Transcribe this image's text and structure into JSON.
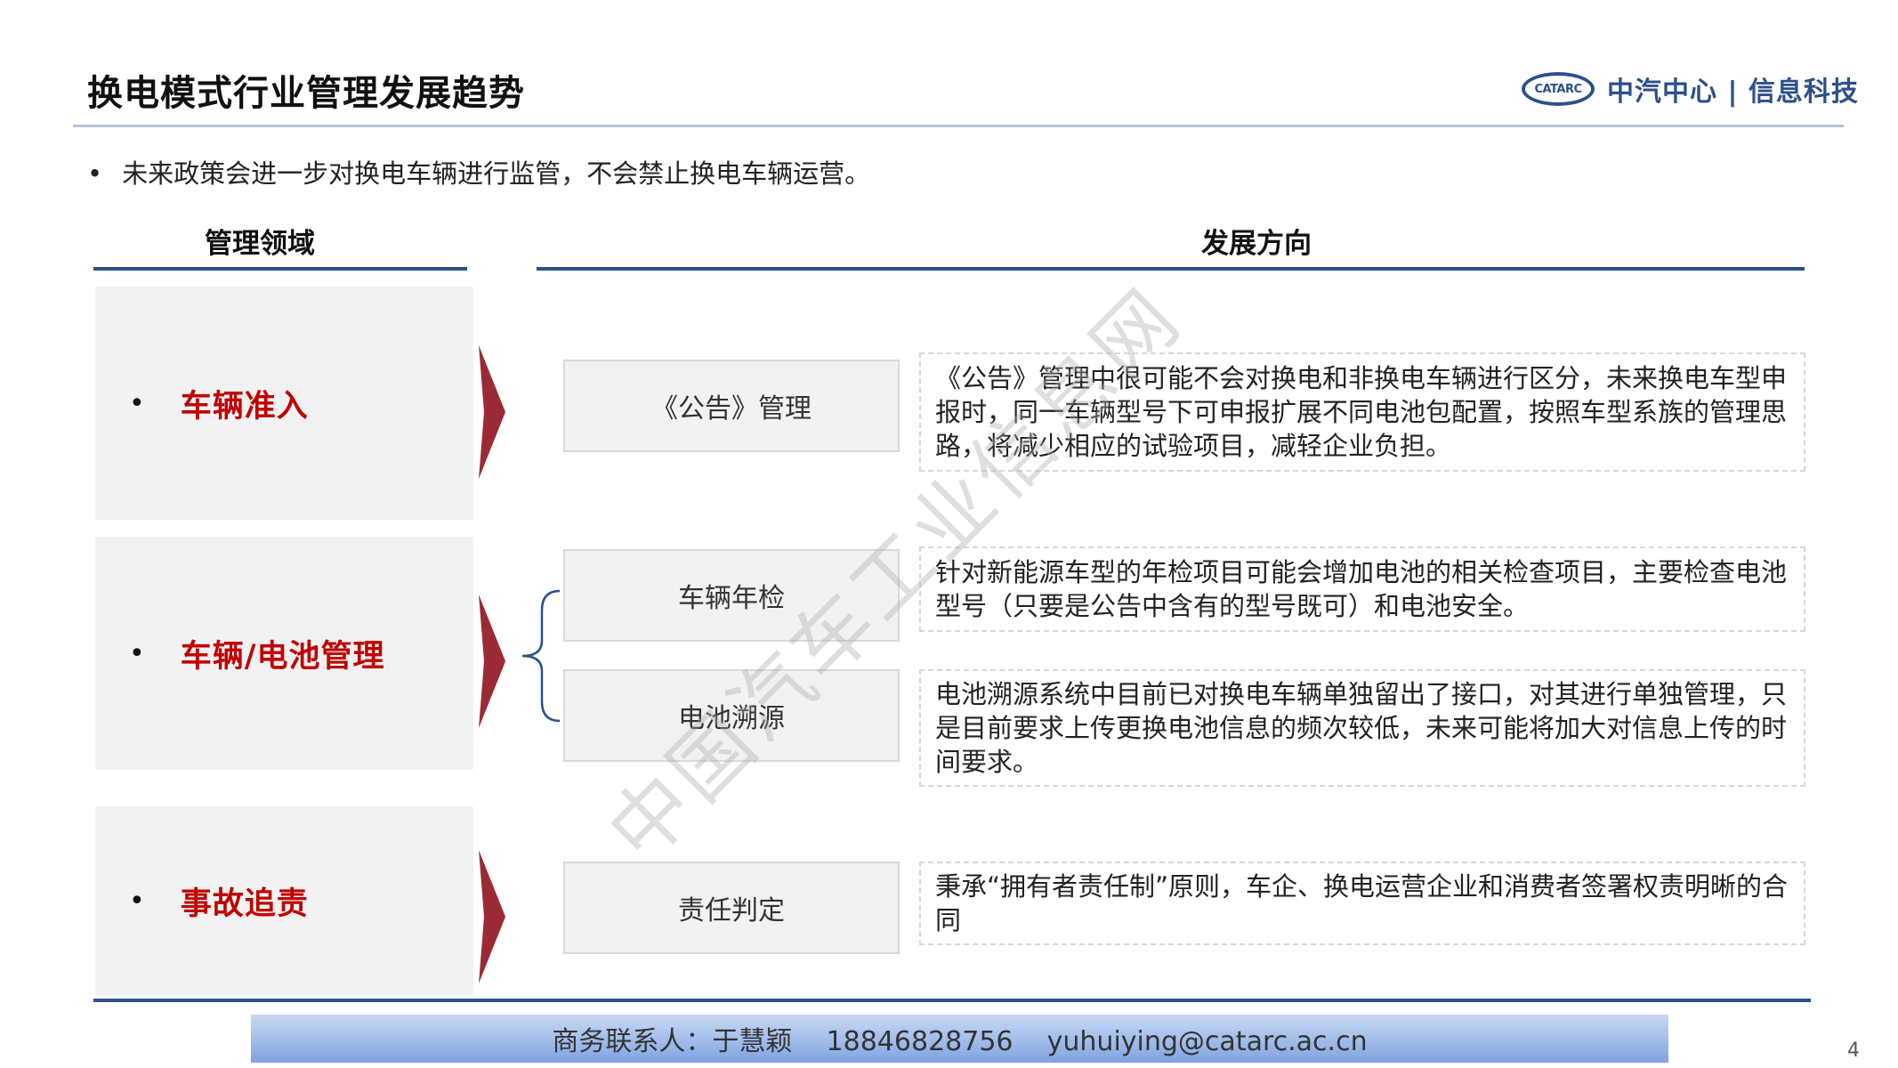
{
  "header": {
    "title": "换电模式行业管理发展趋势",
    "logo_mark": "CATARC",
    "logo_text": "中汽中心 | 信息科技",
    "brand_color": "#2d4f8c"
  },
  "intro": {
    "bullet": "•",
    "text": "未来政策会进一步对换电车辆进行监管，不会禁止换电车辆运营。"
  },
  "columns": {
    "left": "管理领域",
    "right": "发展方向"
  },
  "domains": [
    {
      "bullet": "•",
      "label": "车辆准入"
    },
    {
      "bullet": "•",
      "label": "车辆/电池管理"
    },
    {
      "bullet": "•",
      "label": "事故追责"
    }
  ],
  "items": [
    {
      "name": "《公告》管理",
      "desc": "《公告》管理中很可能不会对换电和非换电车辆进行区分，未来换电车型申报时，同一车辆型号下可申报扩展不同电池包配置，按照车型系族的管理思路，将减少相应的试验项目，减轻企业负担。"
    },
    {
      "name": "车辆年检",
      "desc": "针对新能源车型的年检项目可能会增加电池的相关检查项目，主要检查电池型号（只要是公告中含有的型号既可）和电池安全。"
    },
    {
      "name": "电池溯源",
      "desc": "电池溯源系统中目前已对换电车辆单独留出了接口，对其进行单独管理，只是目前要求上传更换电池信息的频次较低，未来可能将加大对信息上传的时间要求。"
    },
    {
      "name": "责任判定",
      "desc": "秉承“拥有者责任制”原则，车企、换电运营企业和消费者签署权责明晰的合同"
    }
  ],
  "watermark": "中国汽车工业信息网",
  "footer": {
    "contact": "商务联系人：于慧颖    18846828756    yuhuiying@catarc.ac.cn",
    "page": "4"
  },
  "colors": {
    "accent_red": "#c00000",
    "arrow": "#9c2a34",
    "panel": "#f2f2f2"
  }
}
